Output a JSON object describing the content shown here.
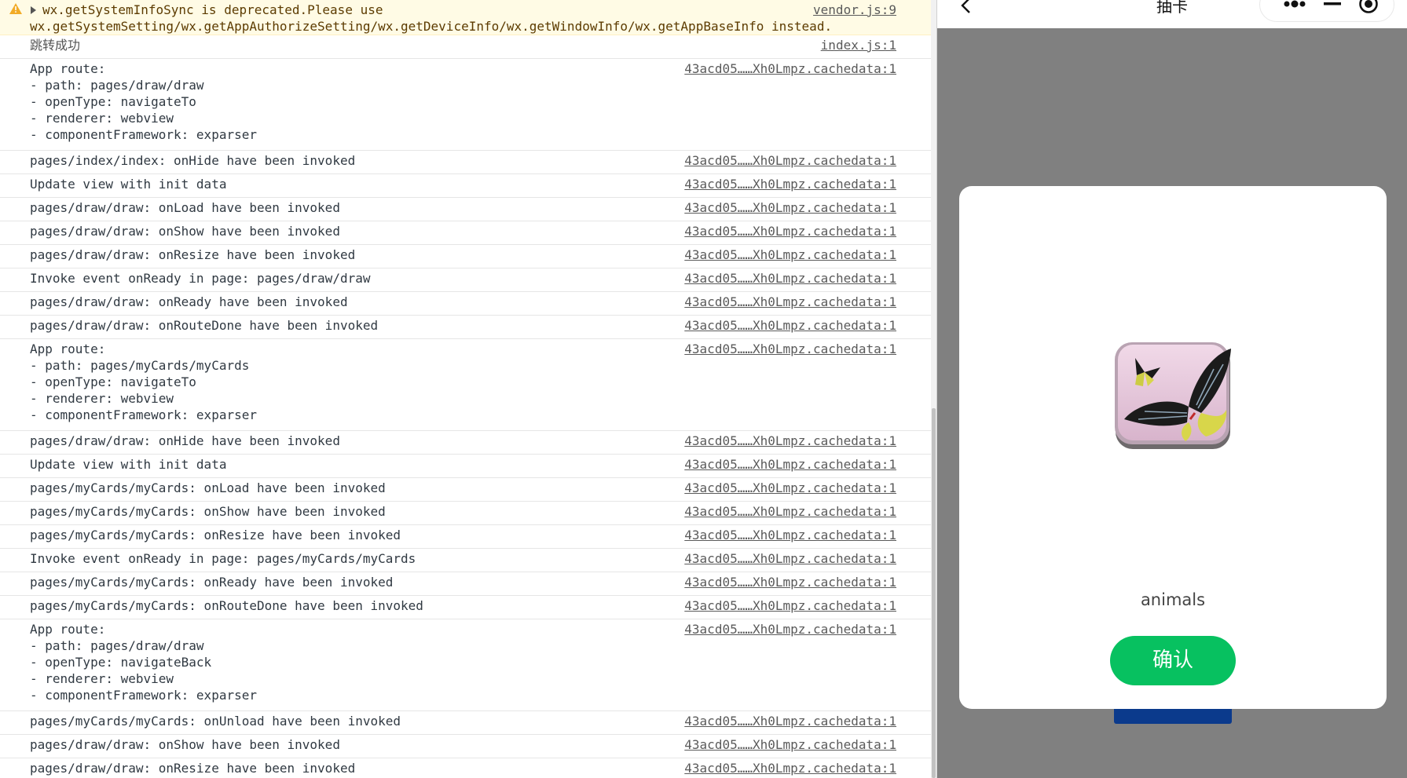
{
  "console": {
    "warning": {
      "line1": "wx.getSystemInfoSync is deprecated.Please use",
      "line2": "wx.getSystemSetting/wx.getAppAuthorizeSetting/wx.getDeviceInfo/wx.getWindowInfo/wx.getAppBaseInfo instead.",
      "source": "vendor.js:9"
    },
    "entries": [
      {
        "text": "跳转成功",
        "source": "index.js:1"
      },
      {
        "text": "App route:\n- path: pages/draw/draw\n- openType: navigateTo\n- renderer: webview\n- componentFramework: exparser",
        "source": "43acd05……Xh0Lmpz.cachedata:1"
      },
      {
        "text": "pages/index/index: onHide have been invoked",
        "source": "43acd05……Xh0Lmpz.cachedata:1"
      },
      {
        "text": "Update view with init data",
        "source": "43acd05……Xh0Lmpz.cachedata:1"
      },
      {
        "text": "pages/draw/draw: onLoad have been invoked",
        "source": "43acd05……Xh0Lmpz.cachedata:1"
      },
      {
        "text": "pages/draw/draw: onShow have been invoked",
        "source": "43acd05……Xh0Lmpz.cachedata:1"
      },
      {
        "text": "pages/draw/draw: onResize have been invoked",
        "source": "43acd05……Xh0Lmpz.cachedata:1"
      },
      {
        "text": "Invoke event onReady in page: pages/draw/draw",
        "source": "43acd05……Xh0Lmpz.cachedata:1"
      },
      {
        "text": "pages/draw/draw: onReady have been invoked",
        "source": "43acd05……Xh0Lmpz.cachedata:1"
      },
      {
        "text": "pages/draw/draw: onRouteDone have been invoked",
        "source": "43acd05……Xh0Lmpz.cachedata:1"
      },
      {
        "text": "App route:\n- path: pages/myCards/myCards\n- openType: navigateTo\n- renderer: webview\n- componentFramework: exparser",
        "source": "43acd05……Xh0Lmpz.cachedata:1"
      },
      {
        "text": "pages/draw/draw: onHide have been invoked",
        "source": "43acd05……Xh0Lmpz.cachedata:1"
      },
      {
        "text": "Update view with init data",
        "source": "43acd05……Xh0Lmpz.cachedata:1"
      },
      {
        "text": "pages/myCards/myCards: onLoad have been invoked",
        "source": "43acd05……Xh0Lmpz.cachedata:1"
      },
      {
        "text": "pages/myCards/myCards: onShow have been invoked",
        "source": "43acd05……Xh0Lmpz.cachedata:1"
      },
      {
        "text": "pages/myCards/myCards: onResize have been invoked",
        "source": "43acd05……Xh0Lmpz.cachedata:1"
      },
      {
        "text": "Invoke event onReady in page: pages/myCards/myCards",
        "source": "43acd05……Xh0Lmpz.cachedata:1"
      },
      {
        "text": "pages/myCards/myCards: onReady have been invoked",
        "source": "43acd05……Xh0Lmpz.cachedata:1"
      },
      {
        "text": "pages/myCards/myCards: onRouteDone have been invoked",
        "source": "43acd05……Xh0Lmpz.cachedata:1"
      },
      {
        "text": "App route:\n- path: pages/draw/draw\n- openType: navigateBack\n- renderer: webview\n- componentFramework: exparser",
        "source": "43acd05……Xh0Lmpz.cachedata:1"
      },
      {
        "text": "pages/myCards/myCards: onUnload have been invoked",
        "source": "43acd05……Xh0Lmpz.cachedata:1"
      },
      {
        "text": "pages/draw/draw: onShow have been invoked",
        "source": "43acd05……Xh0Lmpz.cachedata:1"
      },
      {
        "text": "pages/draw/draw: onResize have been invoked",
        "source": "43acd05……Xh0Lmpz.cachedata:1"
      }
    ]
  },
  "simulator": {
    "nav_title": "抽卡",
    "icons": {
      "back": "chevron-left-icon",
      "more": "more-dots-icon",
      "minimize": "minimize-icon",
      "record": "record-icon"
    },
    "modal": {
      "card_image": "butterfly-image",
      "card_name": "animals",
      "confirm_label": "确认",
      "confirm_color": "#07c160"
    }
  }
}
